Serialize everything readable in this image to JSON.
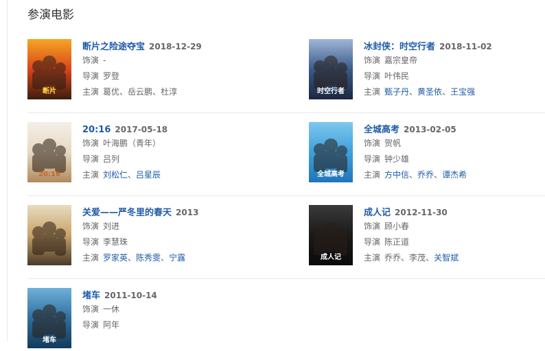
{
  "section": {
    "title": "参演电影"
  },
  "labels": {
    "role": "饰演",
    "director": "导演",
    "starring": "主演"
  },
  "movies": [
    {
      "title": "断片之险途夺宝",
      "date": "2018-12-29",
      "role": "-",
      "director": "罗登",
      "cast": [
        {
          "name": "葛优",
          "link": false
        },
        {
          "name": "岳云鹏",
          "link": false
        },
        {
          "name": "杜淳",
          "link": false
        }
      ],
      "poster": {
        "colors": [
          "#f5a623",
          "#d9451a",
          "#3b1d0e"
        ],
        "caption": "断片",
        "caption_color": "#ffe24a"
      }
    },
    {
      "title": "冰封侠：时空行者",
      "date": "2018-11-02",
      "role": "嘉宗皇帝",
      "director": "叶伟民",
      "cast": [
        {
          "name": "甄子丹",
          "link": true
        },
        {
          "name": "黄圣依",
          "link": true
        },
        {
          "name": "王宝强",
          "link": true
        }
      ],
      "poster": {
        "colors": [
          "#9fb6d6",
          "#3a5a88",
          "#1b2740"
        ],
        "caption": "时空行者",
        "caption_color": "#ffffff"
      }
    },
    {
      "title": "20:16",
      "date": "2017-05-18",
      "role": "叶海鹏（青年）",
      "director": "吕列",
      "cast": [
        {
          "name": "刘松仁",
          "link": true
        },
        {
          "name": "吕星辰",
          "link": true
        }
      ],
      "poster": {
        "colors": [
          "#f4efe6",
          "#e6d9c2",
          "#b08a5c"
        ],
        "caption": "20:16",
        "caption_color": "#c8622b"
      }
    },
    {
      "title": "全城高考",
      "date": "2013-02-05",
      "role": "贺帆",
      "director": "钟少雄",
      "cast": [
        {
          "name": "方中信",
          "link": true
        },
        {
          "name": "乔乔",
          "link": true
        },
        {
          "name": "谭杰希",
          "link": true
        }
      ],
      "poster": {
        "colors": [
          "#7fc7ee",
          "#3ea0dc",
          "#1f76b8"
        ],
        "caption": "全城高考",
        "caption_color": "#ffffff"
      }
    },
    {
      "title": "关爱——严冬里的春天",
      "date": "2013",
      "role": "刘进",
      "director": "李慧珠",
      "cast": [
        {
          "name": "罗家英",
          "link": true
        },
        {
          "name": "陈秀雯",
          "link": true
        },
        {
          "name": "宁露",
          "link": true
        }
      ],
      "poster": {
        "colors": [
          "#e8dcc0",
          "#c9a36a",
          "#4a3a2a"
        ],
        "caption": "",
        "caption_color": "#ffffff"
      }
    },
    {
      "title": "成人记",
      "date": "2012-11-30",
      "role": "顾小春",
      "director": "陈正道",
      "cast": [
        {
          "name": "乔乔",
          "link": false
        },
        {
          "name": "李茂",
          "link": false
        },
        {
          "name": "关智斌",
          "link": true
        }
      ],
      "poster": {
        "colors": [
          "#3a3a3a",
          "#1a1a1a",
          "#0a0a0a"
        ],
        "caption": "成人记",
        "caption_color": "#ffffff"
      }
    },
    {
      "title": "堵车",
      "date": "2011-10-14",
      "role": "一休",
      "director": "阿年",
      "cast": [],
      "poster": {
        "colors": [
          "#6fb1d9",
          "#2f6f9e",
          "#123a5a"
        ],
        "caption": "堵车",
        "caption_color": "#ffffff"
      }
    }
  ]
}
